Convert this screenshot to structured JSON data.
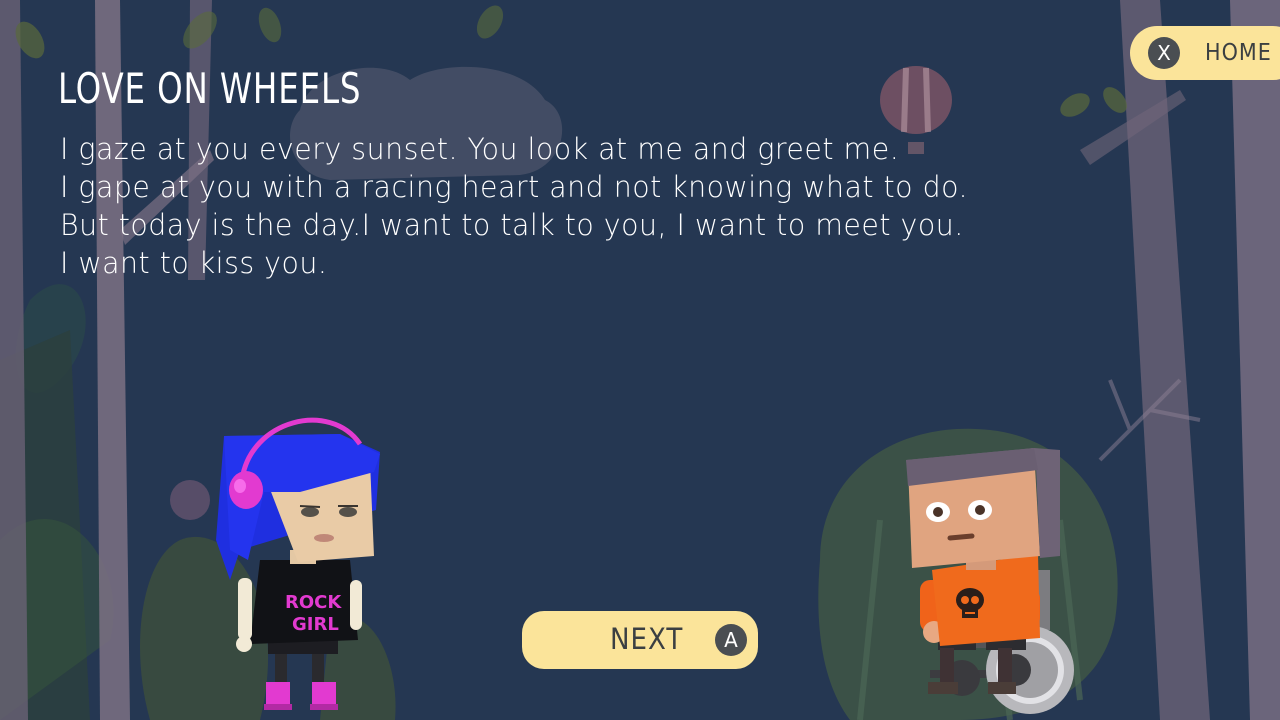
{
  "story": {
    "title": "LOVE ON WHEELS",
    "lines": [
      "I gaze at you every sunset. You look at me and greet me.",
      "I gape at you with a racing heart and not knowing what to do.",
      "But today is the day.I want to talk to you, I want to meet you.",
      "I want to kiss you."
    ]
  },
  "home_button": {
    "key": "X",
    "label": "HOME"
  },
  "next_button": {
    "label": "NEXT",
    "key": "A"
  },
  "characters": {
    "girl_shirt_text": [
      "ROCK",
      "GIRL"
    ]
  },
  "colors": {
    "background": "#253752",
    "button": "#fbe49a",
    "button_key": "#4a4e52",
    "text": "#ffffff"
  }
}
